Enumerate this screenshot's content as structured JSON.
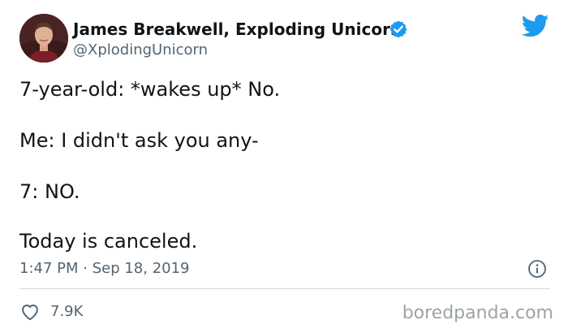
{
  "author": {
    "display_name": "James Breakwell, Exploding Unicorn",
    "handle": "@XplodingUnicorn",
    "verified": true
  },
  "tweet": {
    "lines": [
      "7-year-old: *wakes up* No.",
      "Me: I didn't ask you any-",
      "7: NO.",
      "Today is canceled."
    ],
    "timestamp": "1:47 PM · Sep 18, 2019",
    "like_count": "7.9K"
  },
  "watermark": "boredpanda.com",
  "icons": {
    "verified": "verified-badge-icon",
    "brand": "twitter-bird-icon",
    "info": "info-icon",
    "like": "heart-icon"
  },
  "colors": {
    "twitter_blue": "#1d9bf0",
    "text_primary": "#0f1419",
    "text_secondary": "#536471",
    "divider": "#cfd9de"
  }
}
